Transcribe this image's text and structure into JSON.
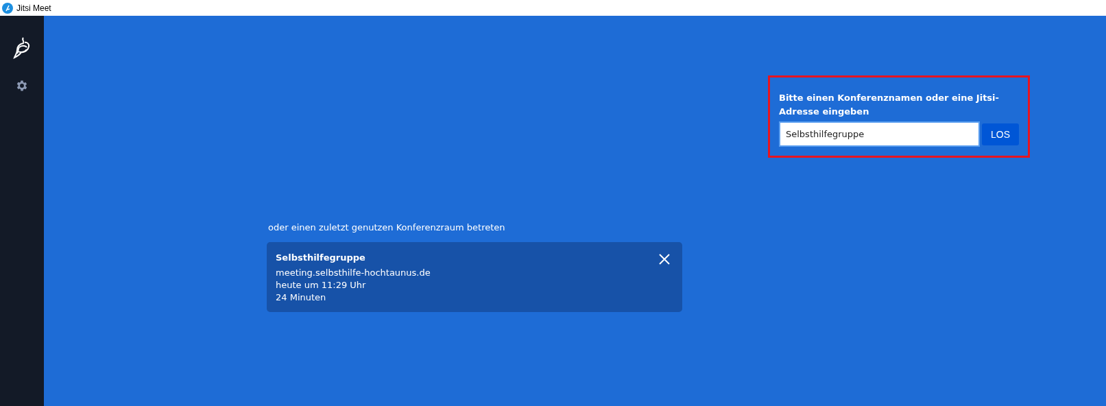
{
  "window": {
    "title": "Jitsi Meet"
  },
  "sidebar": {
    "items": [
      {
        "kind": "logo"
      },
      {
        "kind": "settings"
      }
    ]
  },
  "join": {
    "label": "Bitte einen Konferenznamen oder eine Jitsi-Adresse eingeben",
    "value": "Selbsthilfegruppe",
    "button": "LOS"
  },
  "recent": {
    "heading": "oder einen zuletzt genutzen Konferenzraum betreten",
    "items": [
      {
        "title": "Selbsthilfegruppe",
        "server": "meeting.selbsthilfe-hochtaunus.de",
        "date": "heute um 11:29 Uhr",
        "duration": "24 Minuten"
      }
    ]
  }
}
